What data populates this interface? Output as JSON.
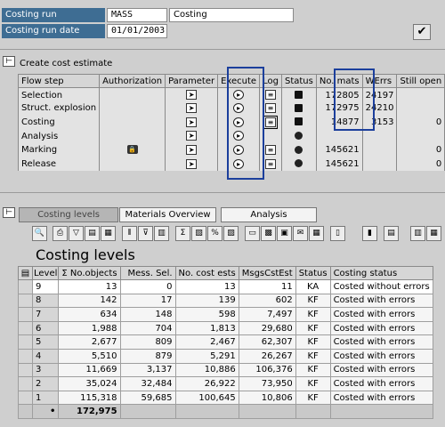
{
  "header": {
    "costing_run_label": "Costing run",
    "costing_run_value": "MASS",
    "costing_run_desc": "Costing",
    "costing_date_label": "Costing run date",
    "costing_date_value": "01/01/2003",
    "check_icon": "check-icon"
  },
  "section1": {
    "title": "Create cost estimate",
    "headers": [
      "Flow step",
      "Authorization",
      "Parameter",
      "Execute",
      "Log",
      "Status",
      "No. mats",
      "WErrs",
      "Still open"
    ],
    "rows": [
      {
        "step": "Selection",
        "mats": "172805",
        "werrs": "24197",
        "open": ""
      },
      {
        "step": "Struct. explosion",
        "mats": "172975",
        "werrs": "24210",
        "open": ""
      },
      {
        "step": "Costing",
        "mats": "14877",
        "werrs": "3153",
        "open": "0"
      },
      {
        "step": "Analysis",
        "mats": "",
        "werrs": "",
        "open": ""
      },
      {
        "step": "Marking",
        "mats": "145621",
        "werrs": "",
        "open": "0"
      },
      {
        "step": "Release",
        "mats": "145621",
        "werrs": "",
        "open": "0"
      }
    ]
  },
  "tabs": [
    {
      "label": "Costing levels",
      "active": true
    },
    {
      "label": "Materials Overview",
      "active": false
    },
    {
      "label": "Analysis",
      "active": false
    }
  ],
  "toolbar_icons": [
    "find-icon",
    "print-icon",
    "filter-icon",
    "layout-icon",
    "detail-icon",
    "columns-icon",
    "setfilter-icon",
    "sortfilter-icon",
    "sum-icon",
    "subtotal-icon",
    "percent-icon",
    "view-icon",
    "export-icon",
    "spreadsheet-icon",
    "word-icon",
    "mail-icon",
    "grid-icon",
    "chart-icon",
    "info-icon",
    "settings-icon",
    "layout-select-icon"
  ],
  "levels": {
    "title": "Costing levels",
    "headers": [
      "Level",
      "Σ No.objects",
      "Mess. Sel.",
      "No. cost ests",
      "MsgsCstEst",
      "Status",
      "Costing status"
    ],
    "rows": [
      {
        "level": "9",
        "objects": "13",
        "mess": "0",
        "ests": "13",
        "msgs": "11",
        "status": "KA",
        "cstatus": "Costed without errors"
      },
      {
        "level": "8",
        "objects": "142",
        "mess": "17",
        "ests": "139",
        "msgs": "602",
        "status": "KF",
        "cstatus": "Costed with errors"
      },
      {
        "level": "7",
        "objects": "634",
        "mess": "148",
        "ests": "598",
        "msgs": "7,497",
        "status": "KF",
        "cstatus": "Costed with errors"
      },
      {
        "level": "6",
        "objects": "1,988",
        "mess": "704",
        "ests": "1,813",
        "msgs": "29,680",
        "status": "KF",
        "cstatus": "Costed with errors"
      },
      {
        "level": "5",
        "objects": "2,677",
        "mess": "809",
        "ests": "2,467",
        "msgs": "62,307",
        "status": "KF",
        "cstatus": "Costed with errors"
      },
      {
        "level": "4",
        "objects": "5,510",
        "mess": "879",
        "ests": "5,291",
        "msgs": "26,267",
        "status": "KF",
        "cstatus": "Costed with errors"
      },
      {
        "level": "3",
        "objects": "11,669",
        "mess": "3,137",
        "ests": "10,886",
        "msgs": "106,376",
        "status": "KF",
        "cstatus": "Costed with errors"
      },
      {
        "level": "2",
        "objects": "35,024",
        "mess": "32,484",
        "ests": "26,922",
        "msgs": "73,950",
        "status": "KF",
        "cstatus": "Costed with errors"
      },
      {
        "level": "1",
        "objects": "115,318",
        "mess": "59,685",
        "ests": "100,645",
        "msgs": "10,806",
        "status": "KF",
        "cstatus": "Costed with errors"
      }
    ],
    "total_marker": "•",
    "total": "172,975"
  }
}
